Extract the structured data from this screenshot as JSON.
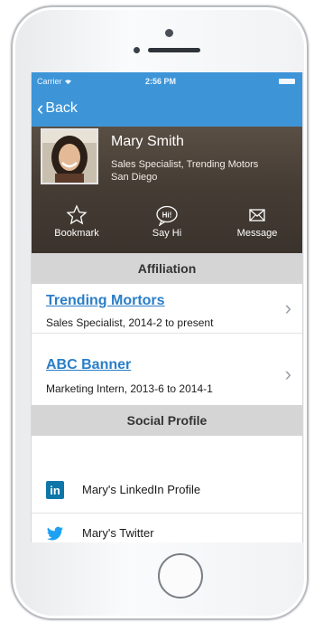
{
  "status_bar": {
    "carrier": "Carrier",
    "time": "2:56 PM"
  },
  "nav": {
    "back_label": "Back"
  },
  "profile": {
    "name": "Mary Smith",
    "title": "Sales Specialist, Trending Motors",
    "city": "San Diego"
  },
  "actions": [
    {
      "label": "Bookmark",
      "icon": "star-icon"
    },
    {
      "label": "Say Hi",
      "icon": "hi-bubble-icon",
      "icon_text": "Hi!"
    },
    {
      "label": "Message",
      "icon": "envelope-icon"
    }
  ],
  "affiliation": {
    "header": "Affiliation",
    "items": [
      {
        "org": "Trending Mortors",
        "detail": "Sales Specialist, 2014-2 to present"
      },
      {
        "org": "ABC Banner",
        "detail": "Marketing Intern, 2013-6 to 2014-1"
      }
    ]
  },
  "social": {
    "header": "Social Profile",
    "items": [
      {
        "label": "Mary's LinkedIn Profile",
        "icon": "linkedin-icon",
        "icon_text": "in"
      },
      {
        "label": "Mary's Twitter",
        "icon": "twitter-icon"
      }
    ]
  },
  "colors": {
    "nav_blue": "#3d95d8",
    "link_blue": "#2a7ec8",
    "section_gray": "#d5d5d5",
    "linkedin_blue": "#0e76a8",
    "twitter_blue": "#1da1f2"
  }
}
